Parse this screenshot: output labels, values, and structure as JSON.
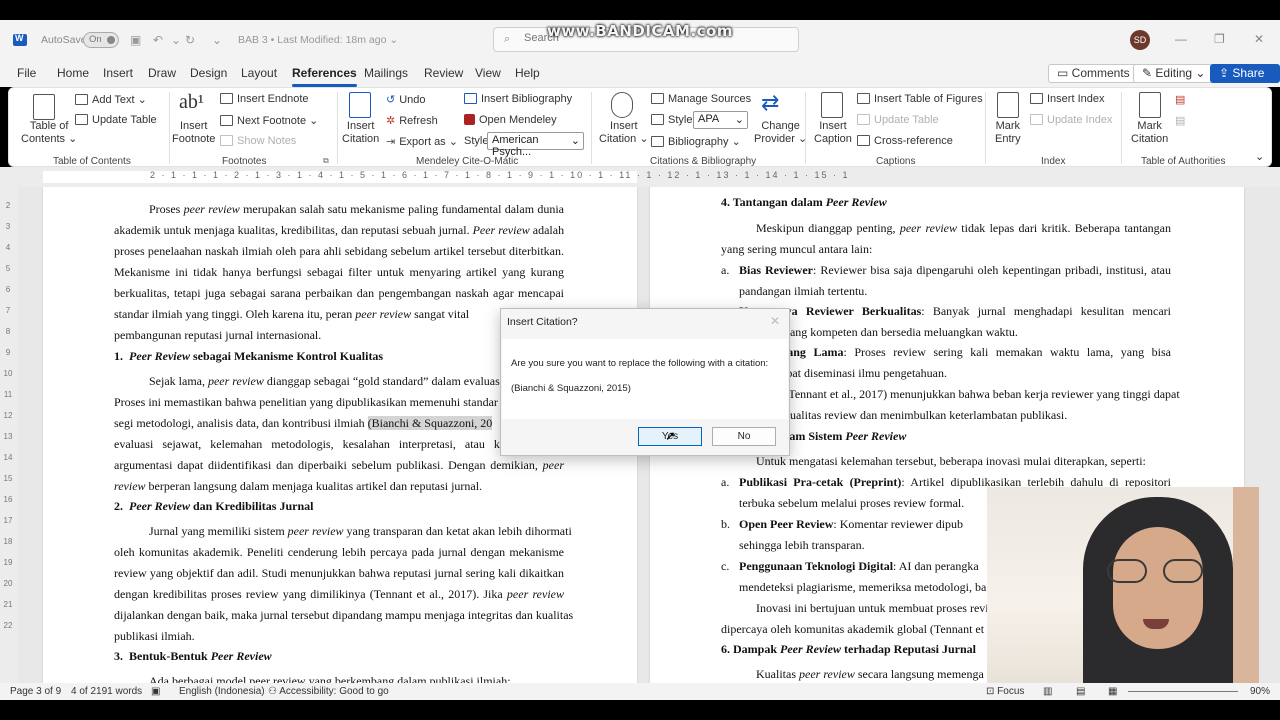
{
  "watermark": "www.BANDICAM.com",
  "titlebar": {
    "autosave_label": "AutoSave",
    "autosave_state": "On",
    "doc_title": "BAB 3 • Last Modified: 18m ago ⌄",
    "search_placeholder": "Search",
    "avatar_initials": "SD",
    "minimize": "—",
    "restore": "❐",
    "close": "✕",
    "brand_color": "#185abd"
  },
  "menu": {
    "tabs": [
      "File",
      "Home",
      "Insert",
      "Draw",
      "Design",
      "Layout",
      "References",
      "Mailings",
      "Review",
      "View",
      "Help"
    ],
    "active": "References",
    "comments": "Comments",
    "editing": "Editing ⌄",
    "share": "Share ⌄"
  },
  "ribbon": {
    "toc": {
      "big": "Table of\nContents ⌄",
      "add_text": "Add Text ⌄",
      "update_table": "Update Table",
      "group": "Table of Contents"
    },
    "footnotes": {
      "insert_footnote": "Insert\nFootnote",
      "insert_endnote": "Insert Endnote",
      "next_footnote": "Next Footnote ⌄",
      "show_notes": "Show Notes",
      "group": "Footnotes"
    },
    "mendeley": {
      "insert_citation": "Insert\nCitation",
      "undo": "Undo",
      "refresh": "Refresh",
      "export_as": "Export as ⌄",
      "insert_bibliography": "Insert Bibliography",
      "open_mendeley": "Open Mendeley",
      "style_label": "Style:",
      "style_value": "American Psych...",
      "group": "Mendeley Cite-O-Matic"
    },
    "citations": {
      "insert_citation": "Insert\nCitation ⌄",
      "manage_sources": "Manage Sources",
      "style_label": "Style:",
      "style_value": "APA",
      "bibliography": "Bibliography ⌄",
      "change_provider": "Change\nProvider ⌄",
      "group": "Citations & Bibliography"
    },
    "captions": {
      "insert_caption": "Insert\nCaption",
      "insert_table_of_figures": "Insert Table of Figures",
      "update_table": "Update Table",
      "cross_reference": "Cross-reference",
      "group": "Captions"
    },
    "index": {
      "mark_entry": "Mark\nEntry",
      "insert_index": "Insert Index",
      "update_index": "Update Index",
      "group": "Index"
    },
    "authorities": {
      "mark_citation": "Mark\nCitation",
      "group": "Table of Authorities"
    }
  },
  "ruler": {
    "numbers": "2 · 1 · 1 · 1 · 2 · 1 · 3 · 1 · 4 · 1 · 5 · 1 · 6 · 1 · 7 · 1 · 8 · 1 · 9 · 1 · 10 · 1 · 11 · 1 · 12 · 1 · 13 · 1 · 14 · 1 · 15 · 1",
    "vertical": [
      "2",
      "3",
      "4",
      "5",
      "6",
      "7",
      "8",
      "9",
      "10",
      "11",
      "12",
      "13",
      "14",
      "15",
      "16",
      "17",
      "18",
      "19",
      "20",
      "21",
      "22"
    ]
  },
  "left_page": {
    "p1": [
      [
        "Proses ",
        "peer review",
        " merupakan salah satu mekanisme paling fundamental dalam dunia"
      ],
      [
        "akademik untuk menjaga kualitas, kredibilitas, dan reputasi sebuah jurnal. ",
        "Peer review",
        " adalah"
      ],
      [
        "proses penelaahan naskah ilmiah oleh para ahli sebidang sebelum artikel tersebut diterbitkan."
      ],
      [
        "Mekanisme ini tidak hanya berfungsi sebagai filter untuk menyaring artikel yang kurang"
      ],
      [
        "berkualitas, tetapi juga sebagai sarana perbaikan dan pengembangan naskah agar mencapai"
      ],
      [
        "standar ilmiah yang tinggi. Oleh karena itu, peran ",
        "peer review",
        " sangat vital"
      ],
      [
        "pembangunan reputasi jurnal internasional."
      ]
    ],
    "h1_num": "1.",
    "h1_it": "Peer Review",
    "h1_rest": " sebagai Mekanisme Kontrol Kualitas",
    "p2": [
      [
        "Sejak lama, ",
        "peer review",
        " dianggap sebagai “gold standard” dalam evaluasi"
      ],
      [
        "Proses ini memastikan bahwa penelitian yang dipublikasikan memenuhi standar a"
      ],
      [
        "segi metodologi, analisis data, dan kontribusi ilmiah ",
        "(Bianchi & Squazzoni, 20",
        ""
      ],
      [
        "evaluasi sejawat, kelemahan metodologis, kesalahan interpretasi, atau k"
      ],
      [
        "argumentasi dapat diidentifikasi dan diperbaiki sebelum publikasi. Dengan demikian, ",
        "peer",
        ""
      ],
      [
        "",
        "review",
        " berperan langsung dalam menjaga kualitas artikel dan reputasi jurnal."
      ]
    ],
    "h2_num": "2.",
    "h2_it": "Peer Review",
    "h2_rest": " dan Kredibilitas Jurnal",
    "p3": [
      [
        "Jurnal yang memiliki sistem ",
        "peer review",
        " yang transparan dan ketat akan lebih dihormati"
      ],
      [
        "oleh komunitas akademik. Peneliti cenderung lebih percaya pada jurnal dengan mekanisme"
      ],
      [
        "review yang objektif dan adil. Studi menunjukkan bahwa reputasi jurnal sering kali dikaitkan"
      ],
      [
        "dengan kredibilitas proses review yang dimilikinya (Tennant et al., 2017). Jika ",
        "peer review",
        ""
      ],
      [
        "dijalankan dengan baik, maka jurnal tersebut dipandang mampu menjaga integritas dan kualitas"
      ],
      [
        "publikasi ilmiah."
      ]
    ],
    "h3_num": "3.",
    "h3_rest": "Bentuk-Bentuk ",
    "h3_it": "Peer Review",
    "last_line": "Ada berbagai model peer review yang berkembang dalam publikasi ilmiah:"
  },
  "right_page": {
    "h4": "4.  Tantangan dalam ",
    "h4_it": "Peer Review",
    "p1a": [
      "Meskipun dianggap penting, ",
      "peer review",
      " tidak lepas dari kritik. Beberapa tantangan"
    ],
    "p1b": "yang sering muncul antara lain:",
    "a_label": "a.",
    "a_bold": "Bias Reviewer",
    "a_rest": ": Reviewer bisa saja dipengaruhi oleh kepentingan pribadi, institusi, atau",
    "a_cont": "pandangan ilmiah tertentu.",
    "b_bold": "Kurangnya Reviewer Berkualitas",
    "b_rest": ": Banyak jurnal menghadapi kesulitan mencari",
    "b_cont": "reviewer yang kompeten dan bersedia meluangkan waktu.",
    "c_bold": "Waktu yang Lama",
    "c_rest": ": Proses review sering kali memakan waktu lama, yang bisa",
    "c_cont": "menghambat diseminasi ilmu pengetahuan.",
    "d_line": "Studi (Tennant et al., 2017) menunjukkan bahwa beban kerja reviewer yang tinggi dapat",
    "d_cont": "menurunkan kualitas review dan menimbulkan keterlambatan publikasi.",
    "h5": "5.  Inovasi dalam Sistem ",
    "h5_it": "Peer Review",
    "p2": "Untuk mengatasi kelemahan tersebut, beberapa inovasi mulai diterapkan, seperti:",
    "i1_label": "a.",
    "i1_bold": "Publikasi Pra-cetak (Preprint)",
    "i1_rest": ": Artikel dipublikasikan terlebih dahulu di repositori",
    "i1_cont": "terbuka sebelum melalui proses review formal.",
    "i2_label": "b.",
    "i2_bold": "Open Peer Review",
    "i2_rest": ": Komentar reviewer dipub",
    "i2_cont": "sehingga lebih transparan.",
    "i3_label": "c.",
    "i3_bold": "Penggunaan Teknologi Digital",
    "i3_rest": ": AI dan perangka",
    "i3_cont": "mendeteksi plagiarisme, memeriksa metodologi, ba",
    "p3a": "Inovasi ini bertujuan untuk membuat proses revi",
    "p3b": "dipercaya oleh komunitas akademik global (Tennant et",
    "h6": "6.  Dampak ",
    "h6_it": "Peer Review",
    "h6_rest": " terhadap Reputasi Jurnal",
    "last_a": "Kualitas ",
    "last_it": "peer review",
    "last_b": " secara langsung memenga"
  },
  "dialog": {
    "title": "Insert Citation?",
    "close": "✕",
    "message": "Are you sure you want to replace the following with a citation:",
    "citation": "(Bianchi & Squazzoni, 2015)",
    "yes": "Yes",
    "no": "No"
  },
  "statusbar": {
    "page": "Page 3 of 9",
    "words": "4 of 2191 words",
    "language": "English (Indonesia)",
    "accessibility": "Accessibility: Good to go",
    "focus": "Focus",
    "zoom": "90%"
  }
}
